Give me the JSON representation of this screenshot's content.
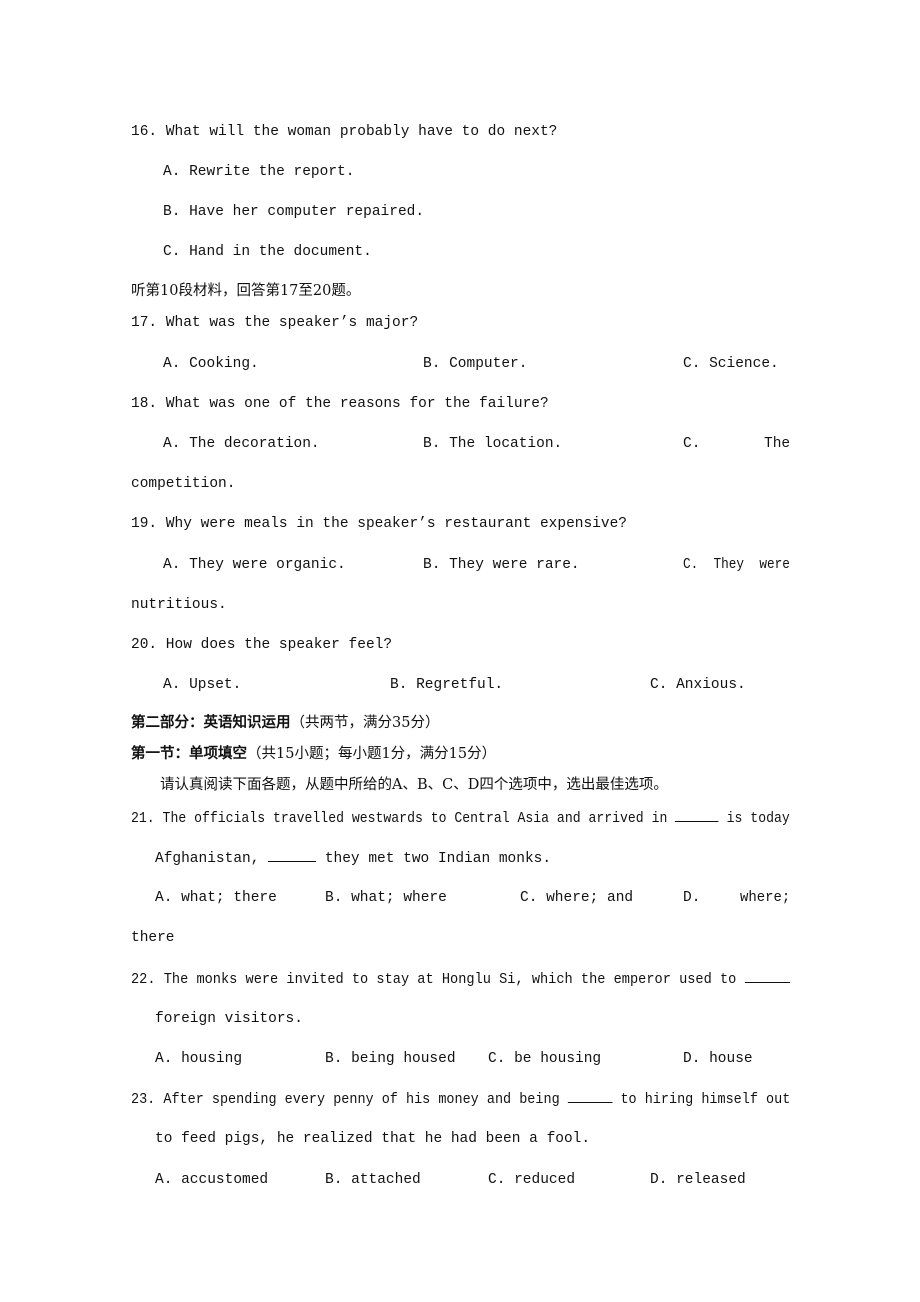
{
  "q16": {
    "stem": "16. What will the woman probably have to do next?",
    "options": [
      "A. Rewrite the report.",
      "B. Have her computer repaired.",
      "C. Hand in the document."
    ]
  },
  "instr_10": "听第10段材料，回答第17至20题。",
  "q17": {
    "stem": "17. What was the speaker’s major?",
    "options": [
      "A. Cooking.",
      "B. Computer.",
      "C. Science."
    ]
  },
  "q18": {
    "stem": "18. What was one of the reasons for the failure?",
    "options": [
      "A. The decoration.",
      "B. The location.",
      "C.",
      "The"
    ],
    "wrap": "competition."
  },
  "q19": {
    "stem": "19. Why were meals in the speaker’s restaurant expensive?",
    "options": [
      "A. They were organic.",
      "B. They were rare.",
      "C.  They  were"
    ],
    "wrap": "nutritious."
  },
  "q20": {
    "stem": "20. How does the speaker feel?",
    "options": [
      "A. Upset.",
      "B. Regretful.",
      "C. Anxious."
    ]
  },
  "part2": {
    "heading_bold": "第二部分：英语知识运用",
    "heading_rest": "（共两节，满分35分）"
  },
  "section1": {
    "heading_bold": "第一节：单项填空",
    "heading_rest": "（共15小题；每小题1分，满分15分）",
    "instruction": "请认真阅读下面各题，从题中所给的A、B、C、D四个选项中，选出最佳选项。"
  },
  "q21": {
    "line1_a": "21. The officials travelled westwards to Central Asia and arrived in",
    "line1_b": "is today",
    "line2_a": "Afghanistan,",
    "line2_b": "they met two Indian monks.",
    "options": [
      "A. what; there",
      "B. what; where",
      "C. where; and",
      "D.",
      "where;"
    ],
    "wrap": "there"
  },
  "q22": {
    "line1": "22. The monks were invited to stay at Honglu Si, which the emperor used to",
    "line2": "foreign visitors.",
    "options": [
      "A. housing",
      "B. being housed",
      "C. be housing",
      "D. house"
    ]
  },
  "q23": {
    "line1_a": "23. After spending every penny of his money and being",
    "line1_b": "to hiring himself out",
    "line2": "to feed pigs, he realized that he had been a fool.",
    "options": [
      "A. accustomed",
      "B. attached",
      "C. reduced",
      "D. released"
    ]
  }
}
